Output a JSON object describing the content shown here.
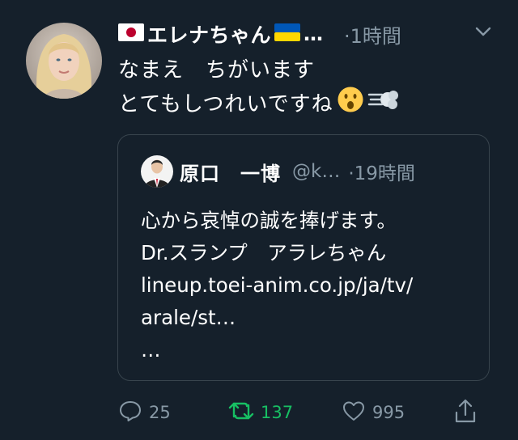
{
  "tweet": {
    "author": {
      "flag_left": "japan-flag-icon",
      "display_name": "エレナちゃん",
      "flag_right": "ukraine-flag-icon",
      "truncation": "…",
      "time": "·1時間"
    },
    "text_lines": [
      "なまえ　ちがいます",
      "とてもしつれいですね"
    ],
    "emojis": [
      "hushed-face-icon",
      "dash-icon"
    ],
    "quote": {
      "display_name": "原口　一博",
      "handle": "@k…",
      "time": "·19時間",
      "text_lines": [
        "心から哀悼の誠を捧げます。",
        "Dr.スランプ　アラレちゃん",
        "lineup.toei-anim.co.jp/ja/tv/",
        "arale/st…",
        "…"
      ]
    },
    "actions": {
      "reply_count": "25",
      "retweet_count": "137",
      "like_count": "995"
    }
  },
  "colors": {
    "background": "#15202b",
    "secondary_text": "#8899a6",
    "retweet_green": "#17bf63",
    "border": "#38444d"
  }
}
